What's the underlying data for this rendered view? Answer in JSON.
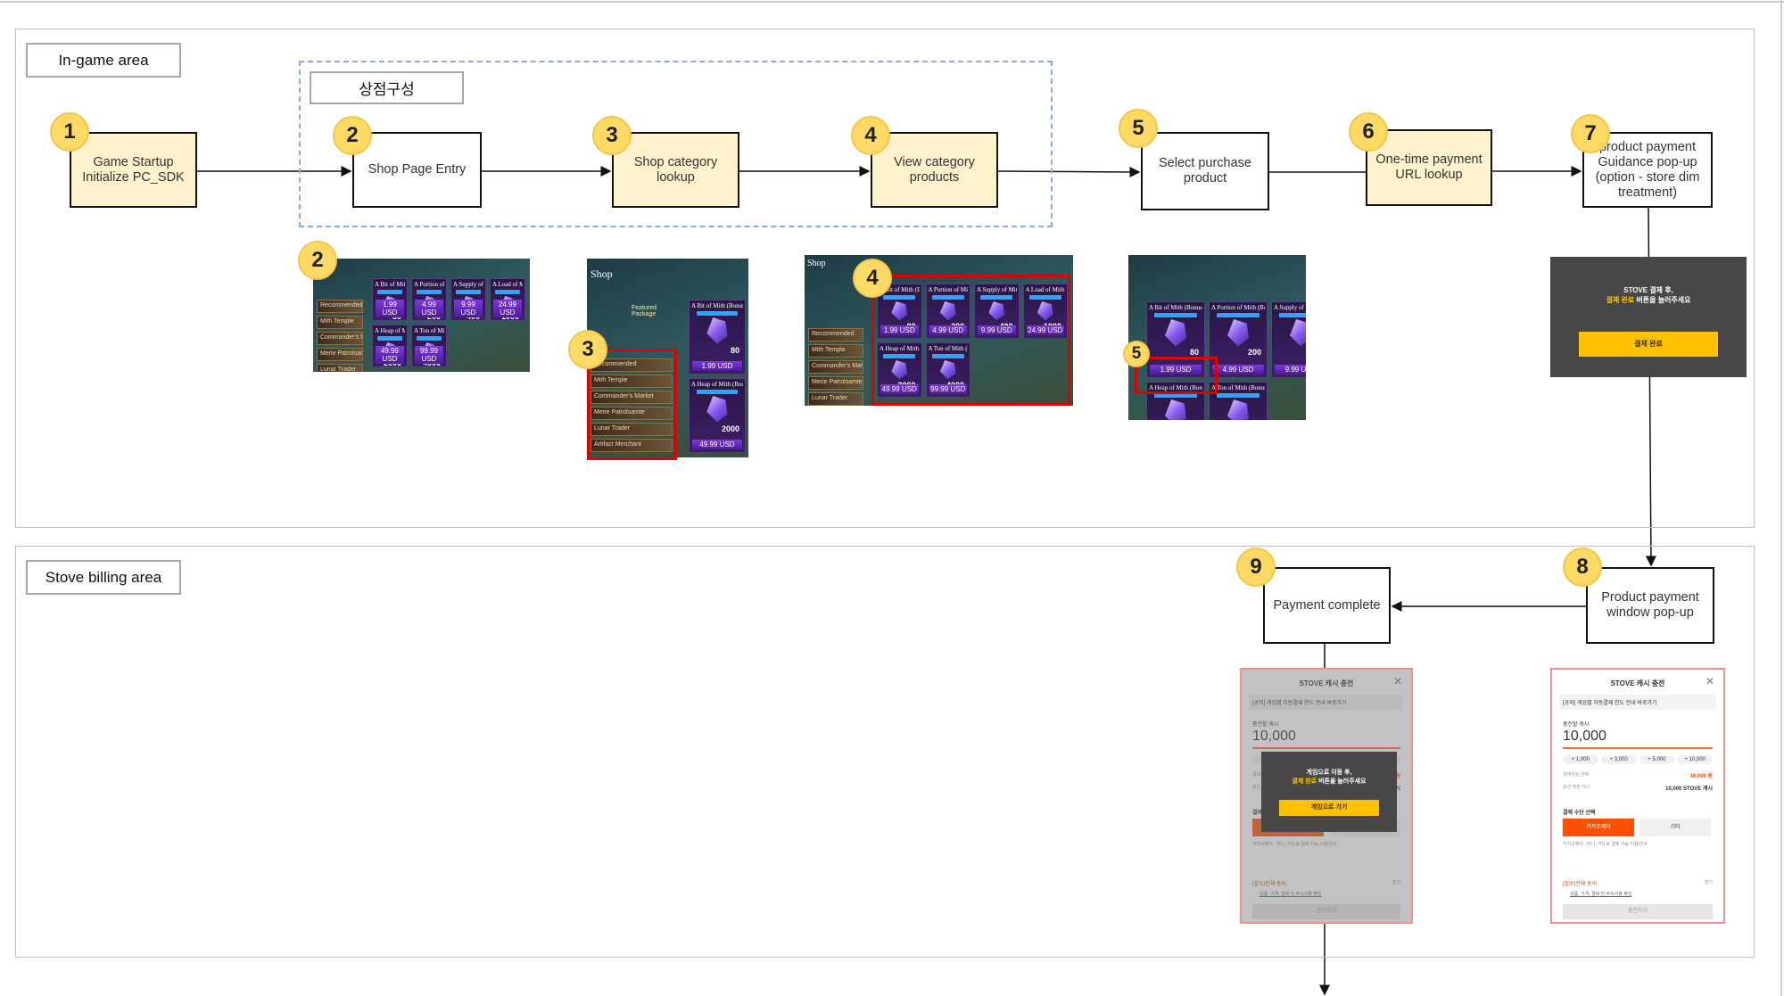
{
  "areas": {
    "ingame": "In-game area",
    "billing": "Stove billing area",
    "shop_group": "상점구성"
  },
  "steps": [
    {
      "num": "1",
      "label": "Game Startup Initialize PC_SDK"
    },
    {
      "num": "2",
      "label": "Shop Page Entry"
    },
    {
      "num": "3",
      "label": "Shop category lookup"
    },
    {
      "num": "4",
      "label": "View category products"
    },
    {
      "num": "5",
      "label": "Select purchase product"
    },
    {
      "num": "6",
      "label": "One-time payment URL lookup"
    },
    {
      "num": "7",
      "label": "product payment Guidance pop-up (option - store dim treatment)"
    },
    {
      "num": "8",
      "label": "Product payment window pop-up"
    },
    {
      "num": "9",
      "label": "Payment complete"
    }
  ],
  "shop": {
    "title": "Shop",
    "featured": "Featured Package",
    "menu": [
      "Recommended",
      "Mith Temple",
      "Commander's Market",
      "Merie Patrolsamte",
      "Lunar Trader",
      "Artifact Merchant"
    ],
    "products": [
      {
        "name": "A Bit of Mith (Bonus)",
        "amount": "80",
        "price": "1.99 USD"
      },
      {
        "name": "A Portion of Mith (Bonus)",
        "amount": "200",
        "price": "4.99 USD"
      },
      {
        "name": "A Supply of Mith (Bonus)",
        "amount": "400",
        "price": "9.99 USD"
      },
      {
        "name": "A Load of Mith (Bonus)",
        "amount": "1000",
        "price": "24.99 USD"
      },
      {
        "name": "A Heap of Mith (Bonus)",
        "amount": "2000",
        "price": "49.99 USD"
      },
      {
        "name": "A Ton of Mith (Bonus)",
        "amount": "4000",
        "price": "99.99 USD"
      }
    ]
  },
  "guidance_popup": {
    "line1": "STOVE 결제 후,",
    "highlight": "결제 완료",
    "line2": " 버튼을 눌러주세요",
    "button": "결제 완료"
  },
  "payment_window": {
    "title": "STOVE 캐시 충전",
    "notice": "[공지] 게임별 자동결제 한도 안내 바로가기",
    "amount_label": "충전할 캐시",
    "amount": "10,000",
    "quick": [
      "+ 1,000",
      "+ 3,000",
      "+ 5,000",
      "+ 10,000"
    ],
    "pay_label": "결제하실 금액",
    "pay_value": "10,000 원",
    "receive_label": "충전 예정 캐시",
    "receive_value": "10,000 STOVE 캐시",
    "method_label": "결제 수단 선택",
    "method_primary": "카카오페이",
    "method_other": "기타",
    "method_note": "카카오페이 : 머니, 카드로 결제 가능  이용안내",
    "agree_all": "[필수]전체 동의",
    "agree_detail": "상품, 가격, 결제 전 주의사항 확인",
    "collapse": "접기",
    "submit": "충전하기"
  },
  "complete_popup": {
    "line1": "게임으로 이동 후,",
    "highlight": "결제 완료",
    "line2": " 버튼을 눌러주세요",
    "button": "게임으로 가기"
  },
  "colors": {
    "step_fill": "#fff2cc",
    "badge": "#ffd966",
    "highlight_box": "#e00000",
    "stove_orange": "#ff5000",
    "gold_button": "#ffc000"
  }
}
